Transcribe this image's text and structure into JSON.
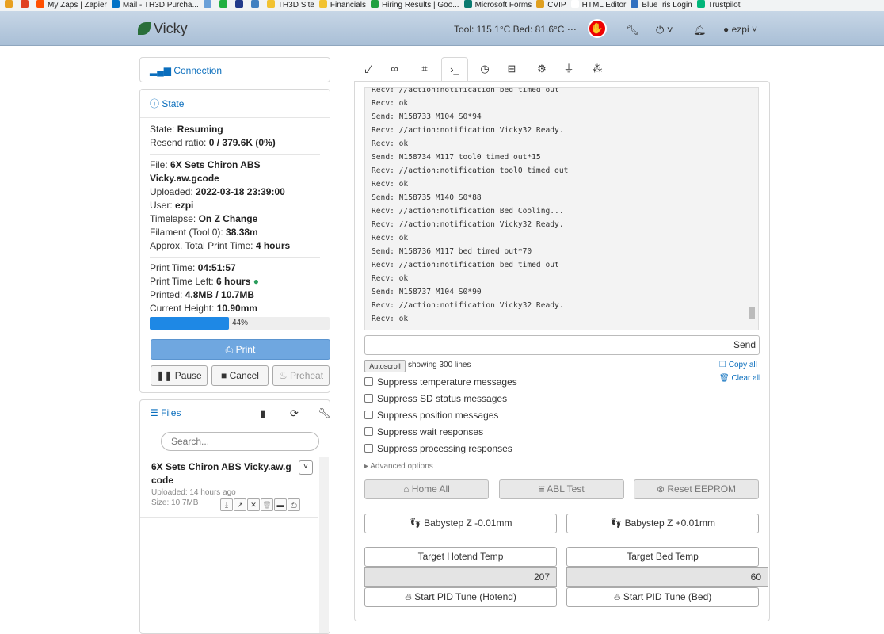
{
  "bookmarks": [
    {
      "label": "",
      "color": "#e8a020"
    },
    {
      "label": "",
      "color": "#e04020"
    },
    {
      "label": "My Zaps | Zapier",
      "color": "#ff4f00"
    },
    {
      "label": "Mail - TH3D Purcha...",
      "color": "#0072c6"
    },
    {
      "label": "",
      "color": "#6aa0d8"
    },
    {
      "label": "",
      "color": "#20b040"
    },
    {
      "label": "",
      "color": "#223a8a"
    },
    {
      "label": "",
      "color": "#4080c0"
    },
    {
      "label": "TH3D Site",
      "color": "#f2c230"
    },
    {
      "label": "Financials",
      "color": "#f2c230"
    },
    {
      "label": "Hiring Results | Goo...",
      "color": "#20a040"
    },
    {
      "label": "Microsoft Forms",
      "color": "#0a7a70"
    },
    {
      "label": "CVIP",
      "color": "#e0a020"
    },
    {
      "label": "HTML Editor",
      "color": "#ffffff"
    },
    {
      "label": "Blue Iris Login",
      "color": "#3070c0"
    },
    {
      "label": "Trustpilot",
      "color": "#00b67a"
    }
  ],
  "navbar": {
    "brand": "Vicky",
    "temps": "Tool: 115.1°C Bed: 81.6°C",
    "user": "ezpi"
  },
  "connection": {
    "title": "Connection"
  },
  "state": {
    "title": "State",
    "state_label": "State: ",
    "state_value": "Resuming",
    "resend_label": "Resend ratio: ",
    "resend_value": "0 / 379.6K (0%)",
    "file_label": "File: ",
    "file_value": "6X Sets Chiron ABS Vicky.aw.gcode",
    "uploaded_label": "Uploaded: ",
    "uploaded_value": "2022-03-18 23:39:00",
    "user_label": "User: ",
    "user_value": "ezpi",
    "timelapse_label": "Timelapse: ",
    "timelapse_value": "On Z Change",
    "filament_label": "Filament (Tool 0): ",
    "filament_value": "38.38m",
    "approx_label": "Approx. Total Print Time: ",
    "approx_value": "4 hours",
    "print_time_label": "Print Time: ",
    "print_time_value": "04:51:57",
    "time_left_label": "Print Time Left: ",
    "time_left_value": "6 hours",
    "printed_label": "Printed: ",
    "printed_value": "4.8MB / 10.7MB",
    "height_label": "Current Height: ",
    "height_value": "10.90mm",
    "progress_pct": 44,
    "progress_text": "44%",
    "print_btn": "Print",
    "pause_btn": "Pause",
    "cancel_btn": "Cancel",
    "preheat_btn": "Preheat"
  },
  "files": {
    "title": "Files",
    "search_placeholder": "Search...",
    "entry": {
      "name": "6X Sets Chiron ABS Vicky.aw.gcode",
      "uploaded": "Uploaded: 14 hours ago",
      "size": "Size: 10.7MB"
    }
  },
  "terminal": {
    "lines": [
      "Recv: //action:notification bed timed out",
      "Recv: ok",
      "Send: N158733 M104 S0*94",
      "Recv: //action:notification Vicky32 Ready.",
      "Recv: ok",
      "Send: N158734 M117 tool0 timed out*15",
      "Recv: //action:notification tool0 timed out",
      "Recv: ok",
      "Send: N158735 M140 S0*88",
      "Recv: //action:notification Bed Cooling...",
      "Recv: //action:notification Vicky32 Ready.",
      "Recv: ok",
      "Send: N158736 M117 bed timed out*70",
      "Recv: //action:notification bed timed out",
      "Recv: ok",
      "Send: N158737 M104 S0*90",
      "Recv: //action:notification Vicky32 Ready.",
      "Recv: ok"
    ],
    "send_btn": "Send",
    "autoscroll": "Autoscroll",
    "showing": "showing 300 lines",
    "copy_all": "Copy all",
    "clear_all": "Clear all",
    "checks": [
      "Suppress temperature messages",
      "Suppress SD status messages",
      "Suppress position messages",
      "Suppress wait responses",
      "Suppress processing responses"
    ],
    "advanced": "Advanced options"
  },
  "controls": {
    "home_all": "Home All",
    "abl_test": "ABL Test",
    "reset_eeprom": "Reset EEPROM",
    "babystep_minus": "Babystep Z -0.01mm",
    "babystep_plus": "Babystep Z +0.01mm",
    "target_hotend": "Target Hotend Temp",
    "target_bed": "Target Bed Temp",
    "hotend_value": "207",
    "bed_value": "60",
    "pid_hotend": "Start PID Tune (Hotend)",
    "pid_bed": "Start PID Tune (Bed)"
  }
}
